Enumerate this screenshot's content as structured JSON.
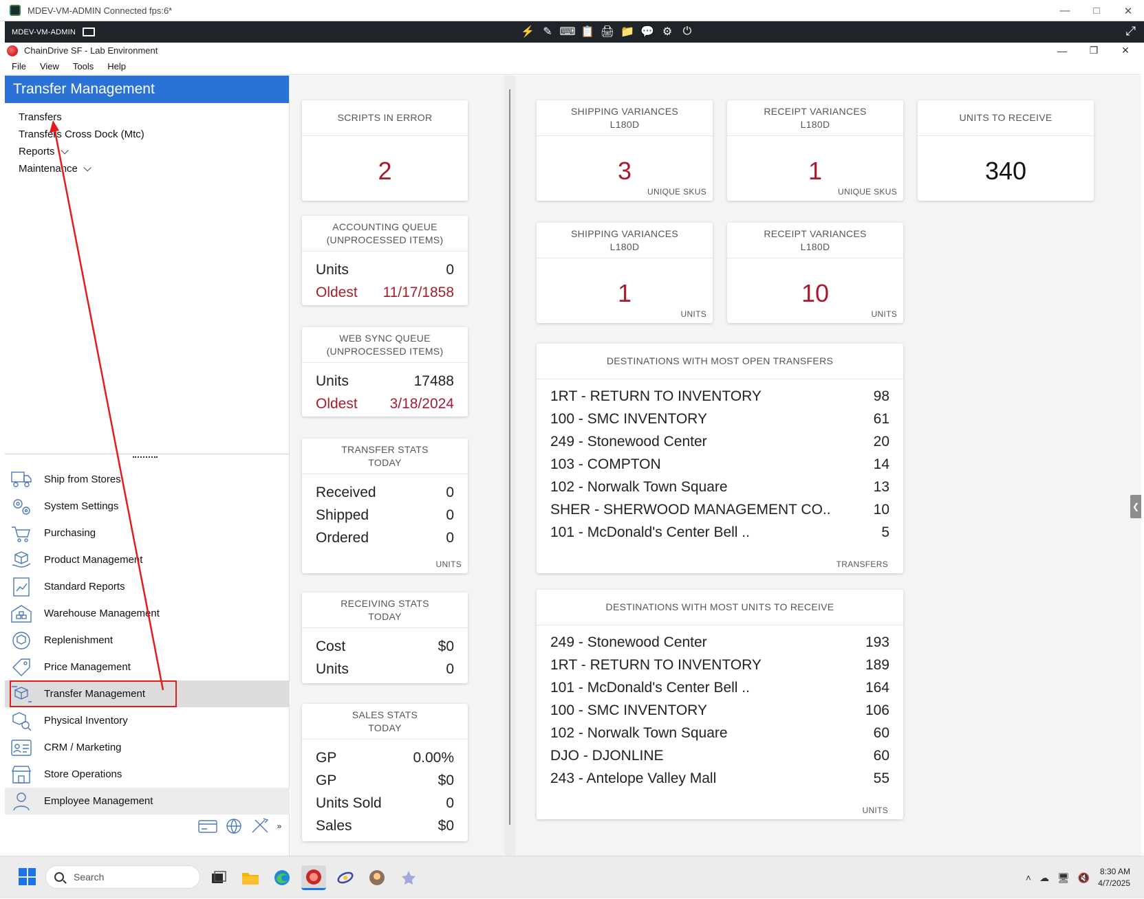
{
  "rdp": {
    "title": "MDEV-VM-ADMIN Connected fps:6*",
    "host_label": "MDEV-VM-ADMIN"
  },
  "app": {
    "title": "ChainDrive SF - Lab Environment",
    "menu": [
      "File",
      "View",
      "Tools",
      "Help"
    ]
  },
  "left_panel": {
    "header": "Transfer Management",
    "nav": [
      {
        "label": "Transfers"
      },
      {
        "label": "Transfers Cross Dock (Mtc)"
      },
      {
        "label": "Reports"
      },
      {
        "label": "Maintenance"
      }
    ],
    "modules": [
      {
        "label": "Ship from Stores",
        "icon": "truck-icon"
      },
      {
        "label": "System Settings",
        "icon": "gears-icon"
      },
      {
        "label": "Purchasing",
        "icon": "cart-icon"
      },
      {
        "label": "Product Management",
        "icon": "box-hand-icon"
      },
      {
        "label": "Standard Reports",
        "icon": "report-chart-icon"
      },
      {
        "label": "Warehouse Management",
        "icon": "warehouse-icon"
      },
      {
        "label": "Replenishment",
        "icon": "replenish-icon"
      },
      {
        "label": "Price Management",
        "icon": "price-tag-icon"
      },
      {
        "label": "Transfer Management",
        "icon": "transfer-box-icon"
      },
      {
        "label": "Physical Inventory",
        "icon": "inventory-search-icon"
      },
      {
        "label": "CRM / Marketing",
        "icon": "contact-card-icon"
      },
      {
        "label": "Store Operations",
        "icon": "store-icon"
      },
      {
        "label": "Employee Management",
        "icon": "employee-icon"
      }
    ]
  },
  "dashboard": {
    "scripts_in_error": {
      "title": "SCRIPTS IN ERROR",
      "value": "2"
    },
    "accounting_queue": {
      "title1": "ACCOUNTING QUEUE",
      "title2": "(UNPROCESSED ITEMS)",
      "units_label": "Units",
      "units_value": "0",
      "oldest_label": "Oldest",
      "oldest_value": "11/17/1858"
    },
    "web_sync_queue": {
      "title1": "WEB SYNC QUEUE",
      "title2": "(UNPROCESSED ITEMS)",
      "units_label": "Units",
      "units_value": "17488",
      "oldest_label": "Oldest",
      "oldest_value": "3/18/2024"
    },
    "transfer_stats": {
      "title1": "TRANSFER STATS",
      "title2": "TODAY",
      "rows": [
        {
          "label": "Received",
          "value": "0"
        },
        {
          "label": "Shipped",
          "value": "0"
        },
        {
          "label": "Ordered",
          "value": "0"
        }
      ],
      "footer": "UNITS"
    },
    "receiving_stats": {
      "title1": "RECEIVING STATS",
      "title2": "TODAY",
      "rows": [
        {
          "label": "Cost",
          "value": "$0"
        },
        {
          "label": "Units",
          "value": "0"
        }
      ]
    },
    "sales_stats": {
      "title1": "SALES STATS",
      "title2": "TODAY",
      "rows": [
        {
          "label": "GP",
          "value": "0.00%"
        },
        {
          "label": "GP",
          "value": "$0"
        },
        {
          "label": "Units Sold",
          "value": "0"
        },
        {
          "label": "Sales",
          "value": "$0"
        }
      ]
    },
    "ship_var_skus": {
      "title1": "SHIPPING VARIANCES",
      "title2": "L180D",
      "value": "3",
      "footer": "UNIQUE SKUS"
    },
    "rec_var_skus": {
      "title1": "RECEIPT VARIANCES",
      "title2": "L180D",
      "value": "1",
      "footer": "UNIQUE SKUS"
    },
    "units_to_receive": {
      "title": "UNITS TO RECEIVE",
      "value": "340"
    },
    "ship_var_units": {
      "title1": "SHIPPING VARIANCES",
      "title2": "L180D",
      "value": "1",
      "footer": "UNITS"
    },
    "rec_var_units": {
      "title1": "RECEIPT VARIANCES",
      "title2": "L180D",
      "value": "10",
      "footer": "UNITS"
    },
    "open_transfers": {
      "title": "DESTINATIONS WITH MOST OPEN TRANSFERS",
      "rows": [
        {
          "label": "1RT - RETURN TO INVENTORY",
          "value": "98"
        },
        {
          "label": "100 - SMC INVENTORY",
          "value": "61"
        },
        {
          "label": "249 - Stonewood Center",
          "value": "20"
        },
        {
          "label": "103 - COMPTON",
          "value": "14"
        },
        {
          "label": "102 - Norwalk Town Square",
          "value": "13"
        },
        {
          "label": "SHER - SHERWOOD MANAGEMENT CO..",
          "value": "10"
        },
        {
          "label": "101 - McDonald's Center Bell ..",
          "value": "5"
        }
      ],
      "footer": "TRANSFERS"
    },
    "units_to_receive_dest": {
      "title": "DESTINATIONS WITH MOST UNITS TO RECEIVE",
      "rows": [
        {
          "label": "249 - Stonewood Center",
          "value": "193"
        },
        {
          "label": "1RT - RETURN TO INVENTORY",
          "value": "189"
        },
        {
          "label": "101 - McDonald's Center Bell ..",
          "value": "164"
        },
        {
          "label": "100 - SMC INVENTORY",
          "value": "106"
        },
        {
          "label": "102 - Norwalk Town Square",
          "value": "60"
        },
        {
          "label": "DJO - DJONLINE",
          "value": "60"
        },
        {
          "label": "243 - Antelope Valley Mall",
          "value": "55"
        }
      ],
      "footer": "UNITS"
    }
  },
  "taskbar": {
    "search_placeholder": "Search",
    "time": "8:30 AM",
    "date": "4/7/2025"
  },
  "colors": {
    "header_blue": "#2b72d6",
    "value_red": "#a51d2d",
    "annotation_red": "#e21b1b"
  }
}
